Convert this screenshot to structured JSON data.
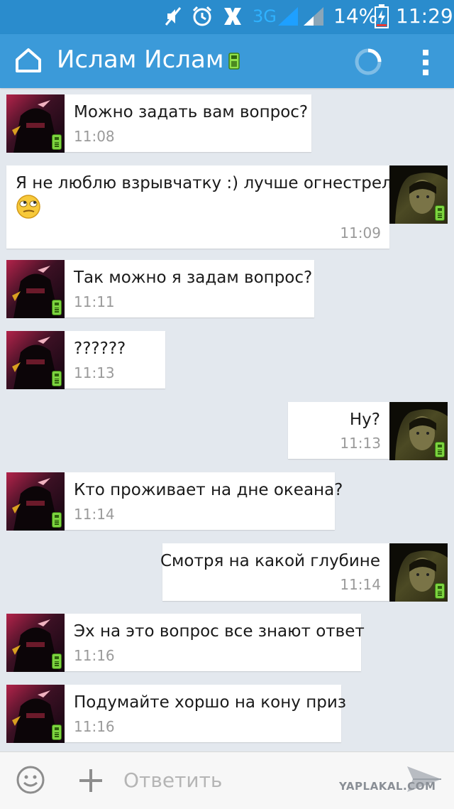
{
  "status_bar": {
    "network": "3G",
    "battery": "14%",
    "time": "11:29"
  },
  "header": {
    "title": "Ислам Ислам"
  },
  "messages": [
    {
      "side": "in",
      "text": "Можно задать вам вопрос?",
      "time": "11:08"
    },
    {
      "side": "out",
      "text_line1": "Я не люблю взрывчатку :) лучше огнестрел",
      "emoji": "rolling-eyes-emoji",
      "time": "11:09"
    },
    {
      "side": "in",
      "text": "Так можно я задам вопрос?",
      "time": "11:11"
    },
    {
      "side": "in",
      "text": "??????",
      "time": "11:13"
    },
    {
      "side": "out",
      "text": "Ну?",
      "time": "11:13"
    },
    {
      "side": "in",
      "text": "Кто проживает на дне океана?",
      "time": "11:14"
    },
    {
      "side": "out",
      "text": "Смотря на какой глубине",
      "time": "11:14"
    },
    {
      "side": "in",
      "text": "Эх на это вопрос все знают ответ",
      "time": "11:16"
    },
    {
      "side": "in",
      "text": "Подумайте хоршо на кону приз",
      "time": "11:16"
    }
  ],
  "input": {
    "placeholder": "Ответить"
  },
  "watermark": "YAPLAKAL.COM",
  "colors": {
    "status_bar": "#2a8ccd",
    "app_bar": "#3b9ad9",
    "background": "#e3e8ee",
    "bubble": "#ffffff",
    "mobile_badge": "#7cd33f"
  }
}
